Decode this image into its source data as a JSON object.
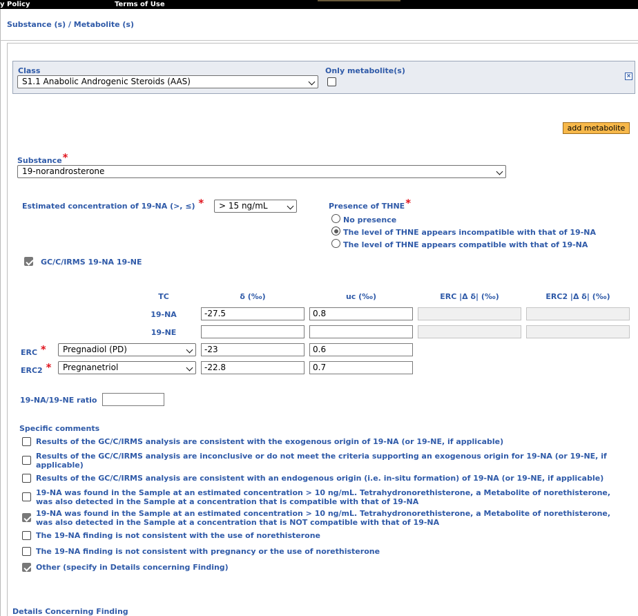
{
  "topbar": {
    "privacy": "y Policy",
    "terms": "Terms of Use"
  },
  "section": {
    "title": "Substance (s) / Metabolite (s)"
  },
  "class_box": {
    "class_label": "Class",
    "class_value": "S1.1 Anabolic Androgenic Steroids (AAS)",
    "only_metabolite_label": "Only metabolite(s)",
    "close_glyph": "×"
  },
  "add_metabolite": "add metabolite",
  "substance": {
    "label": "Substance",
    "required": "*",
    "value": "19-norandrosterone"
  },
  "concentration": {
    "label": "Estimated concentration of 19-NA (>, ≤)",
    "required": "*",
    "value": "> 15 ng/mL"
  },
  "thne": {
    "label": "Presence of THNE",
    "required": "*",
    "options": [
      {
        "label": "No presence",
        "selected": false
      },
      {
        "label": "The level of THNE appears incompatible with that of 19-NA",
        "selected": true
      },
      {
        "label": "The level of THNE appears compatible with that of 19-NA",
        "selected": false
      }
    ]
  },
  "gcirms": {
    "label": "GC/C/IRMS 19-NA 19-NE",
    "checked": true
  },
  "table": {
    "headers": {
      "tc": "TC",
      "delta": "δ (‰)",
      "uc": "uc (‰)",
      "erc": "ERC |Δ δ| (‰)",
      "erc2": "ERC2 |Δ δ| (‰)"
    },
    "rows": {
      "na": {
        "label": "19-NA",
        "delta": "-27.5",
        "uc": "0.8"
      },
      "ne": {
        "label": "19-NE",
        "delta": "",
        "uc": ""
      },
      "erc": {
        "label": "ERC",
        "required": "*",
        "select": "Pregnadiol (PD)",
        "delta": "-23",
        "uc": "0.6"
      },
      "erc2": {
        "label": "ERC2",
        "required": "*",
        "select": "Pregnanetriol",
        "delta": "-22.8",
        "uc": "0.7"
      }
    }
  },
  "ratio": {
    "label": "19-NA/19-NE ratio",
    "value": ""
  },
  "comments": {
    "label": "Specific comments",
    "items": [
      {
        "text": "Results of the GC/C/IRMS analysis are consistent with the exogenous origin of 19-NA (or 19-NE, if applicable)",
        "checked": false
      },
      {
        "text": "Results of the GC/C/IRMS analysis are inconclusive or do not meet the criteria supporting an exogenous origin for 19-NA (or 19-NE, if applicable)",
        "checked": false
      },
      {
        "text": "Results of the GC/C/IRMS analysis are consistent with an endogenous origin (i.e. in-situ formation) of 19-NA (or 19-NE, if applicable)",
        "checked": false
      },
      {
        "text": "19-NA was found in the Sample at an estimated concentration > 10 ng/mL. Tetrahydronorethisterone, a Metabolite of norethisterone, was also detected in the Sample at a concentration that is compatible with that of 19-NA",
        "checked": false
      },
      {
        "text": "19-NA was found in the Sample at an estimated concentration > 10 ng/mL. Tetrahydronorethisterone, a Metabolite of norethisterone, was also detected in the Sample at a concentration that is NOT compatible with that of 19-NA",
        "checked": true
      },
      {
        "text": "The 19-NA finding is not consistent with the use of norethisterone",
        "checked": false
      },
      {
        "text": "The 19-NA finding is not consistent with pregnancy or the use of norethisterone",
        "checked": false
      },
      {
        "text": "Other (specify in Details concerning Finding)",
        "checked": true
      }
    ]
  },
  "details": {
    "label": "Details Concerning Finding"
  },
  "colors": {
    "label_blue": "#2f5aa8",
    "required_red": "#e0141e",
    "button_orange": "#f7b84a",
    "panel_grey": "#e9ecf2"
  }
}
